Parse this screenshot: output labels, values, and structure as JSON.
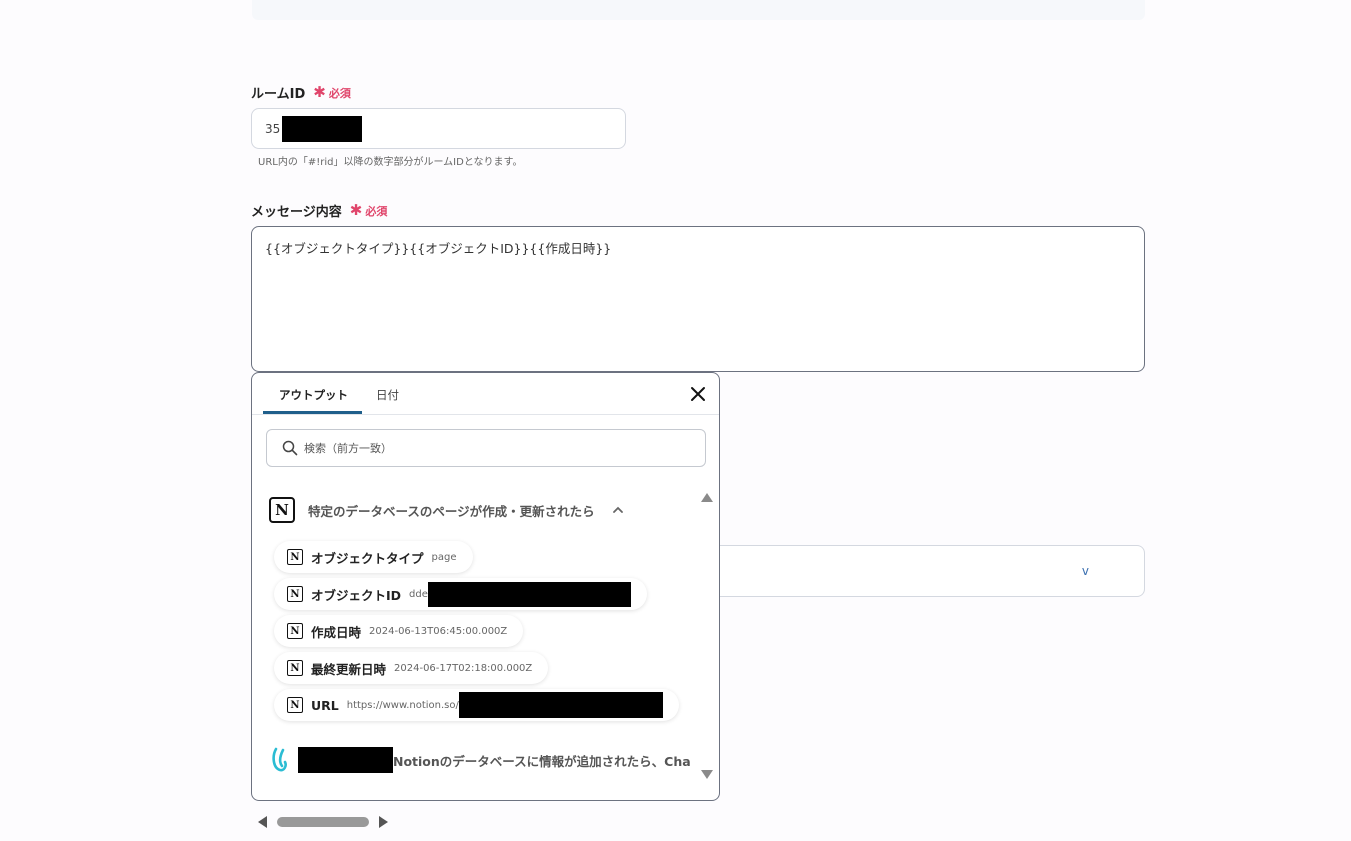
{
  "room_id": {
    "label": "ルームID",
    "required": "必須",
    "value": "35",
    "hint": "URL内の「#!rid」以降の数字部分がルームIDとなります。"
  },
  "message": {
    "label": "メッセージ内容",
    "required": "必須",
    "value": "{{オブジェクトタイプ}}{{オブジェクトID}}{{作成日時}}"
  },
  "behind_select": {
    "chevron": "v"
  },
  "popup": {
    "tabs": [
      {
        "label": "アウトプット",
        "active": true
      },
      {
        "label": "日付",
        "active": false
      }
    ],
    "search_placeholder": "検索（前方一致）",
    "group1": {
      "icon": "notion-icon",
      "title": "特定のデータベースのページが作成・更新されたら",
      "items": [
        {
          "label": "オブジェクトタイプ",
          "value": "page"
        },
        {
          "label": "オブジェクトID",
          "value": "dde"
        },
        {
          "label": "作成日時",
          "value": "2024-06-13T06:45:00.000Z"
        },
        {
          "label": "最終更新日時",
          "value": "2024-06-17T02:18:00.000Z"
        },
        {
          "label": "URL",
          "value": "https://www.notion.so/"
        }
      ]
    },
    "group2": {
      "icon": "chatwork-icon",
      "title": "Notionのデータベースに情報が追加されたら、Cha"
    }
  },
  "colors": {
    "required": "#e0456b",
    "tab_underline": "#1f5f8b",
    "border": "#6c7280"
  }
}
